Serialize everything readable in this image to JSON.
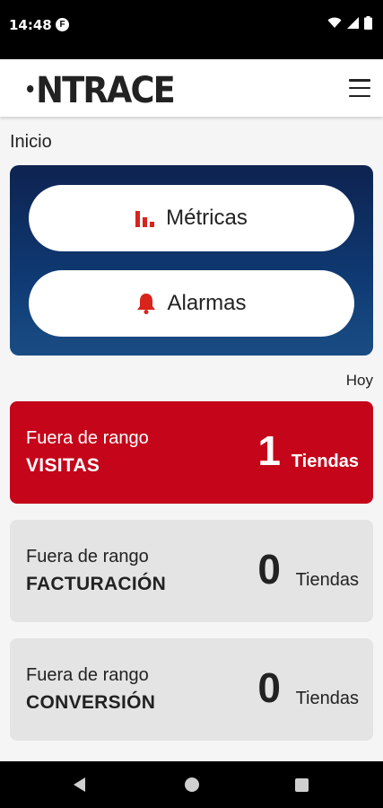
{
  "status_bar": {
    "time": "14:48",
    "app_badge": "F"
  },
  "header": {
    "logo_text": "NTRACE"
  },
  "page": {
    "title": "Inicio"
  },
  "nav_buttons": [
    {
      "label": "Métricas",
      "icon": "bar-chart-icon",
      "icon_color": "#d9231d"
    },
    {
      "label": "Alarmas",
      "icon": "bell-icon",
      "icon_color": "#d9231d"
    }
  ],
  "date_filter": "Hoy",
  "cards": [
    {
      "subtitle": "Fuera de rango",
      "metric": "VISITAS",
      "count": "1",
      "unit": "Tiendas",
      "background": "#c5061a"
    },
    {
      "subtitle": "Fuera de rango",
      "metric": "FACTURACIÓN",
      "count": "0",
      "unit": "Tiendas",
      "background": "#e4e4e4"
    },
    {
      "subtitle": "Fuera de rango",
      "metric": "CONVERSIÓN",
      "count": "0",
      "unit": "Tiendas",
      "background": "#e4e4e4"
    }
  ]
}
